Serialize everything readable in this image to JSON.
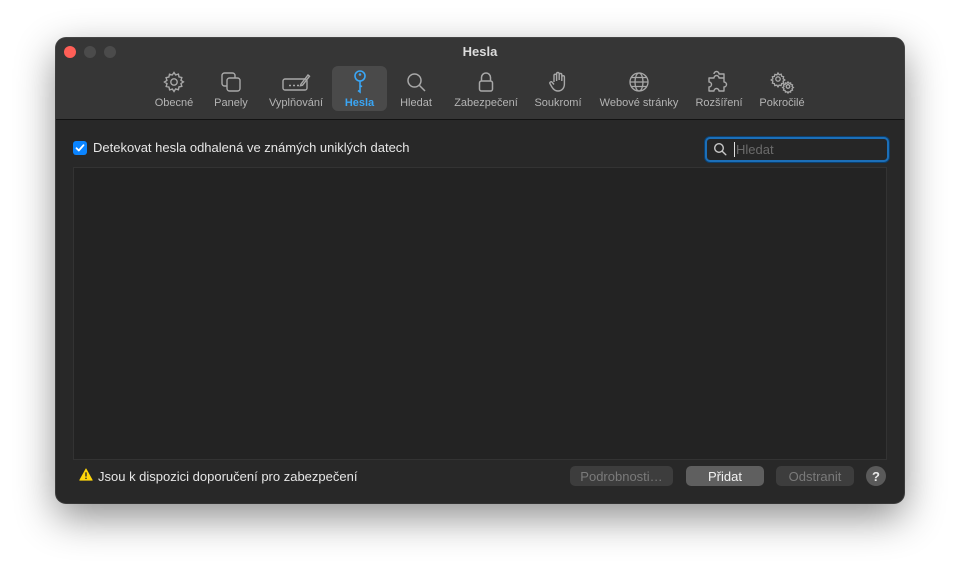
{
  "window": {
    "title": "Hesla"
  },
  "toolbar": {
    "items": [
      {
        "label": "Obecné",
        "icon": "gear-icon"
      },
      {
        "label": "Panely",
        "icon": "tabs-icon"
      },
      {
        "label": "Vyplňování",
        "icon": "pen-icon"
      },
      {
        "label": "Hesla",
        "icon": "key-icon",
        "selected": true
      },
      {
        "label": "Hledat",
        "icon": "search-icon"
      },
      {
        "label": "Zabezpečení",
        "icon": "lock-icon"
      },
      {
        "label": "Soukromí",
        "icon": "hand-icon"
      },
      {
        "label": "Webové stránky",
        "icon": "globe-icon"
      },
      {
        "label": "Rozšíření",
        "icon": "puzzle-icon"
      },
      {
        "label": "Pokročilé",
        "icon": "gears-icon"
      }
    ]
  },
  "content": {
    "detect_label": "Detekovat hesla odhalená ve známých uniklých datech",
    "detect_checked": true,
    "search": {
      "placeholder": "Hledat",
      "value": ""
    }
  },
  "footer": {
    "warning_text": "Jsou k dispozici doporučení pro zabezpečení",
    "details_label": "Podrobnosti…",
    "add_label": "Přidat",
    "remove_label": "Odstranit",
    "help_label": "?"
  },
  "colors": {
    "accent": "#0a84ff",
    "selected_label": "#3aa6f5",
    "warning": "#ffd60a",
    "close_button": "#ff5f57"
  }
}
